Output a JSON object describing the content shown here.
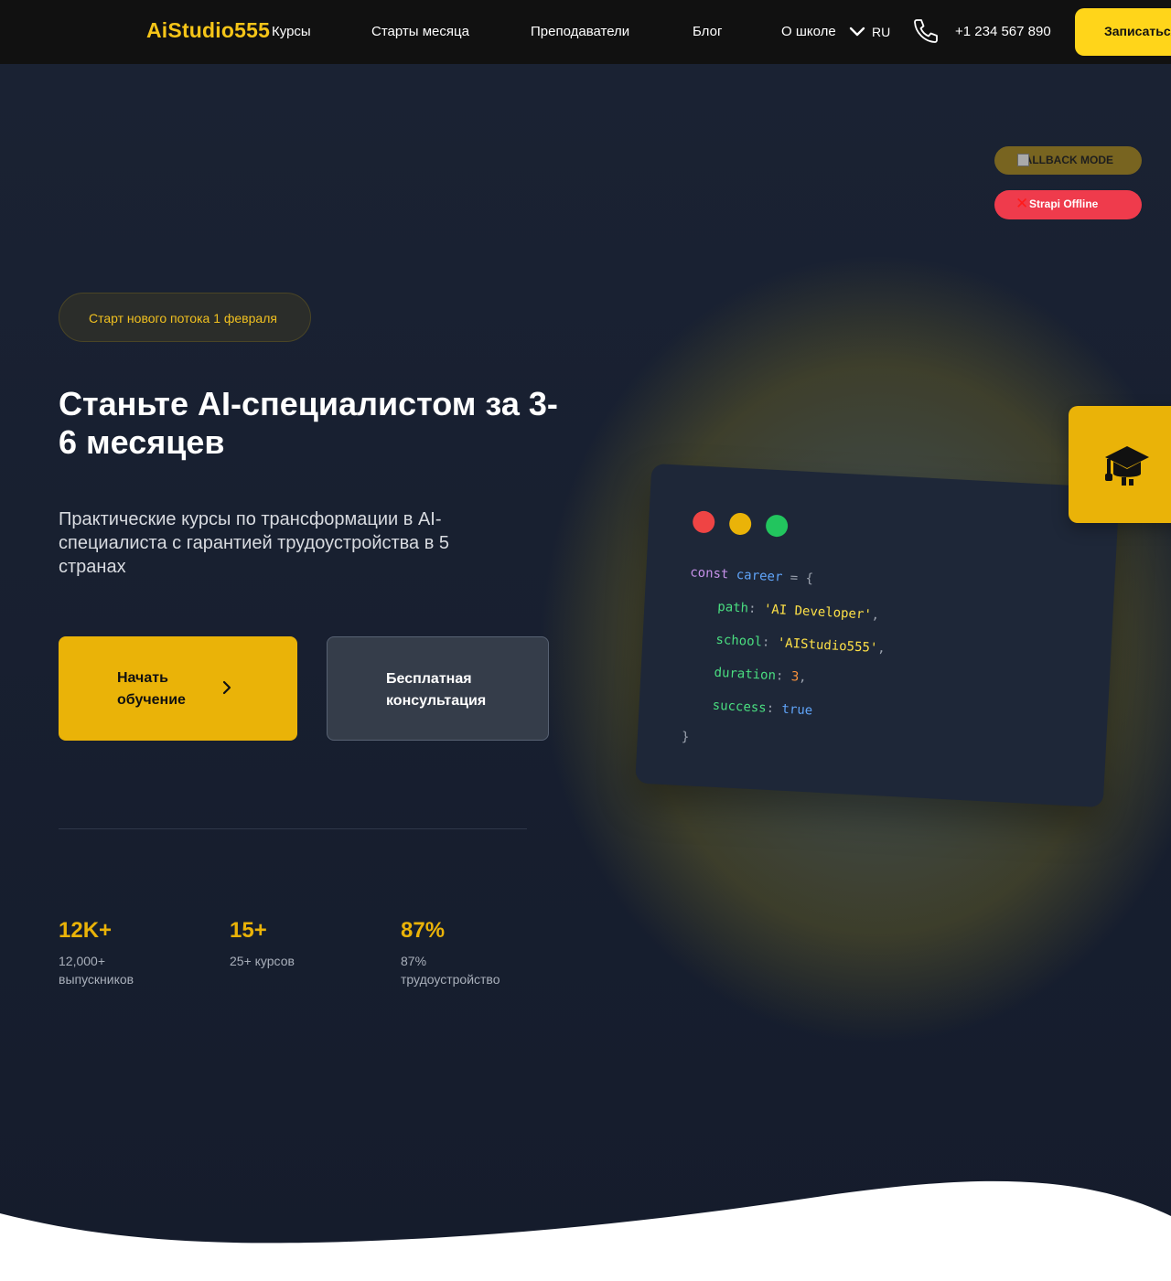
{
  "nav": {
    "logo": "AiStudio555",
    "links": [
      "Курсы",
      "Старты месяца",
      "Преподаватели",
      "Блог",
      "О школе"
    ],
    "lang": "RU",
    "phone": "+1 234 567 890",
    "cta": "Записаться"
  },
  "badges": {
    "fallback": "FALLBACK MODE",
    "offline": "Strapi Offline"
  },
  "hero": {
    "pill": "Старт нового потока 1 февраля",
    "title": "Станьте AI-специалистом за 3-6 месяцев",
    "lead": "Практические курсы по трансформации в AI-специалиста с гарантией трудоустройства в 5 странах",
    "primary_cta": "Начать обучение",
    "secondary_cta": "Бесплатная консультация"
  },
  "stats": [
    {
      "value": "12K+",
      "label": "12,000+ выпускников"
    },
    {
      "value": "15+",
      "label": "25+ курсов"
    },
    {
      "value": "87%",
      "label": "87% трудоустройство"
    }
  ],
  "code": {
    "line1_kw": "const",
    "line1_var": "career",
    "line1_rest": " = {",
    "fields": [
      {
        "key": "path",
        "value": "'AI Developer'",
        "type": "str",
        "trail": ","
      },
      {
        "key": "school",
        "value": "'AIStudio555'",
        "type": "str",
        "trail": ","
      },
      {
        "key": "duration",
        "value": "3",
        "type": "num",
        "trail": ","
      },
      {
        "key": "success",
        "value": "true",
        "type": "bool",
        "trail": ""
      }
    ],
    "close": "}"
  },
  "colors": {
    "accent": "#eab308",
    "nav_bg": "#111111",
    "hero_bg": "#1a2233",
    "offline_red": "#ef3b4c",
    "dot_red": "#ef4444",
    "dot_yellow": "#eab308",
    "dot_green": "#22c55e"
  },
  "icons": {
    "lang_toggle": "chevron-down-icon",
    "phone": "phone-icon",
    "primary_cta": "chevron-right-icon",
    "side_tab": "graduation-cap-icon",
    "fallback": "broken-image-icon",
    "offline": "x-icon"
  }
}
